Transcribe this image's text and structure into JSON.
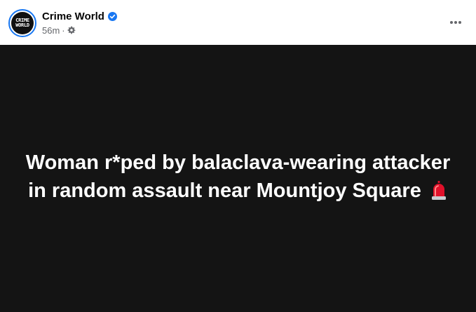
{
  "post": {
    "page_name": "Crime World",
    "verified": true,
    "timestamp": "56m",
    "separator": "·",
    "audience_icon": "gear-icon",
    "avatar_text": [
      "CRIME",
      "WORLD"
    ],
    "more_icon": "ellipsis-icon",
    "text": "Woman r*ped by balaclava-wearing attacker in random assault near Mountjoy Square",
    "emoji_icon": "police-siren-icon"
  },
  "colors": {
    "body_background": "#141414",
    "header_background": "#ffffff",
    "verified_badge": "#1877f2",
    "meta_text": "#65676b",
    "siren_red": "#e0102a"
  }
}
